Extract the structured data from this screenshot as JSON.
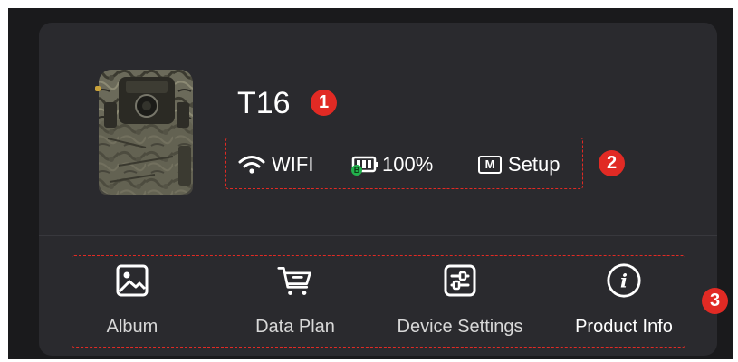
{
  "device": {
    "name": "T16"
  },
  "status": {
    "connection_label": "WIFI",
    "battery_label": "100%",
    "battery_indicator": "B",
    "mode_badge": "M",
    "mode_label": "Setup"
  },
  "actions": [
    {
      "label": "Album",
      "icon": "image-icon"
    },
    {
      "label": "Data Plan",
      "icon": "cart-icon"
    },
    {
      "label": "Device Settings",
      "icon": "sliders-icon"
    },
    {
      "label": "Product Info",
      "icon": "info-icon"
    }
  ],
  "annotations": {
    "badge_1": "1",
    "badge_2": "2",
    "badge_3": "3",
    "color": "#e12a24"
  },
  "colors": {
    "background": "#1a1a1c",
    "card": "#2a2a2e",
    "text": "#ffffff",
    "action_label": "#d8d8d8",
    "battery_dot": "#22b14c"
  }
}
